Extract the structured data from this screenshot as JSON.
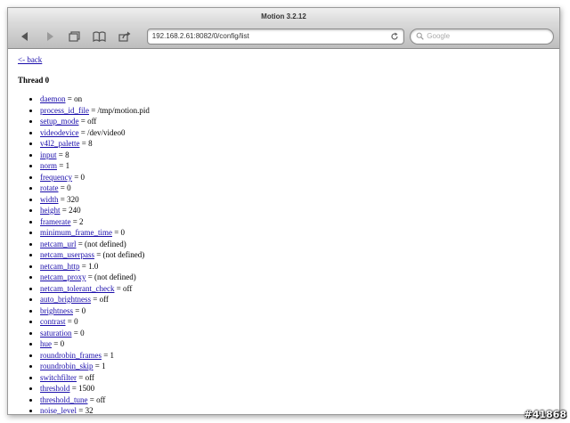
{
  "window": {
    "title": "Motion 3.2.12"
  },
  "toolbar": {
    "url": "192.168.2.61:8082/0/config/list",
    "search_placeholder": "Google"
  },
  "page": {
    "back_label": "<- back",
    "thread_title": "Thread 0",
    "settings": [
      {
        "name": "daemon",
        "value": " = on"
      },
      {
        "name": "process_id_file",
        "value": " = /tmp/motion.pid"
      },
      {
        "name": "setup_mode",
        "value": " = off"
      },
      {
        "name": "videodevice",
        "value": " = /dev/video0"
      },
      {
        "name": "v4l2_palette",
        "value": " = 8"
      },
      {
        "name": "input",
        "value": " = 8"
      },
      {
        "name": "norm",
        "value": " = 1"
      },
      {
        "name": "frequency",
        "value": " = 0"
      },
      {
        "name": "rotate",
        "value": " = 0"
      },
      {
        "name": "width",
        "value": " = 320"
      },
      {
        "name": "height",
        "value": " = 240"
      },
      {
        "name": "framerate",
        "value": " = 2"
      },
      {
        "name": "minimum_frame_time",
        "value": " = 0"
      },
      {
        "name": "netcam_url",
        "value": " = (not defined)"
      },
      {
        "name": "netcam_userpass",
        "value": " = (not defined)"
      },
      {
        "name": "netcam_http",
        "value": " = 1.0"
      },
      {
        "name": "netcam_proxy",
        "value": " = (not defined)"
      },
      {
        "name": "netcam_tolerant_check",
        "value": " = off"
      },
      {
        "name": "auto_brightness",
        "value": " = off"
      },
      {
        "name": "brightness",
        "value": " = 0"
      },
      {
        "name": "contrast",
        "value": " = 0"
      },
      {
        "name": "saturation",
        "value": " = 0"
      },
      {
        "name": "hue",
        "value": " = 0"
      },
      {
        "name": "roundrobin_frames",
        "value": " = 1"
      },
      {
        "name": "roundrobin_skip",
        "value": " = 1"
      },
      {
        "name": "switchfilter",
        "value": " = off"
      },
      {
        "name": "threshold",
        "value": " = 1500"
      },
      {
        "name": "threshold_tune",
        "value": " = off"
      },
      {
        "name": "noise_level",
        "value": " = 32"
      }
    ]
  },
  "watermark": "#41868",
  "colors": {
    "link": "#1a0dab"
  }
}
